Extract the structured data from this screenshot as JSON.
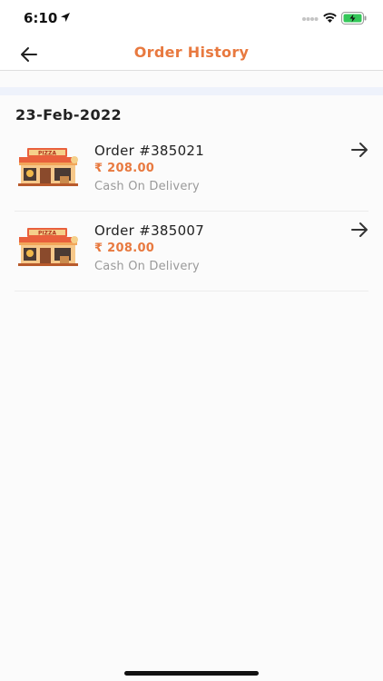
{
  "status_bar": {
    "time": "6:10"
  },
  "header": {
    "title": "Order History",
    "back_icon": "arrow-left-icon"
  },
  "groups": [
    {
      "date": "23-Feb-2022",
      "orders": [
        {
          "title": "Order #385021",
          "amount": "₹ 208.00",
          "payment": "Cash On Delivery",
          "thumbnail_label": "PIZZA"
        },
        {
          "title": "Order #385007",
          "amount": "₹ 208.00",
          "payment": "Cash On Delivery",
          "thumbnail_label": "PIZZA"
        }
      ]
    }
  ],
  "colors": {
    "accent": "#e8793f",
    "muted_text": "#9a9a9a",
    "band": "#eef2fb"
  }
}
